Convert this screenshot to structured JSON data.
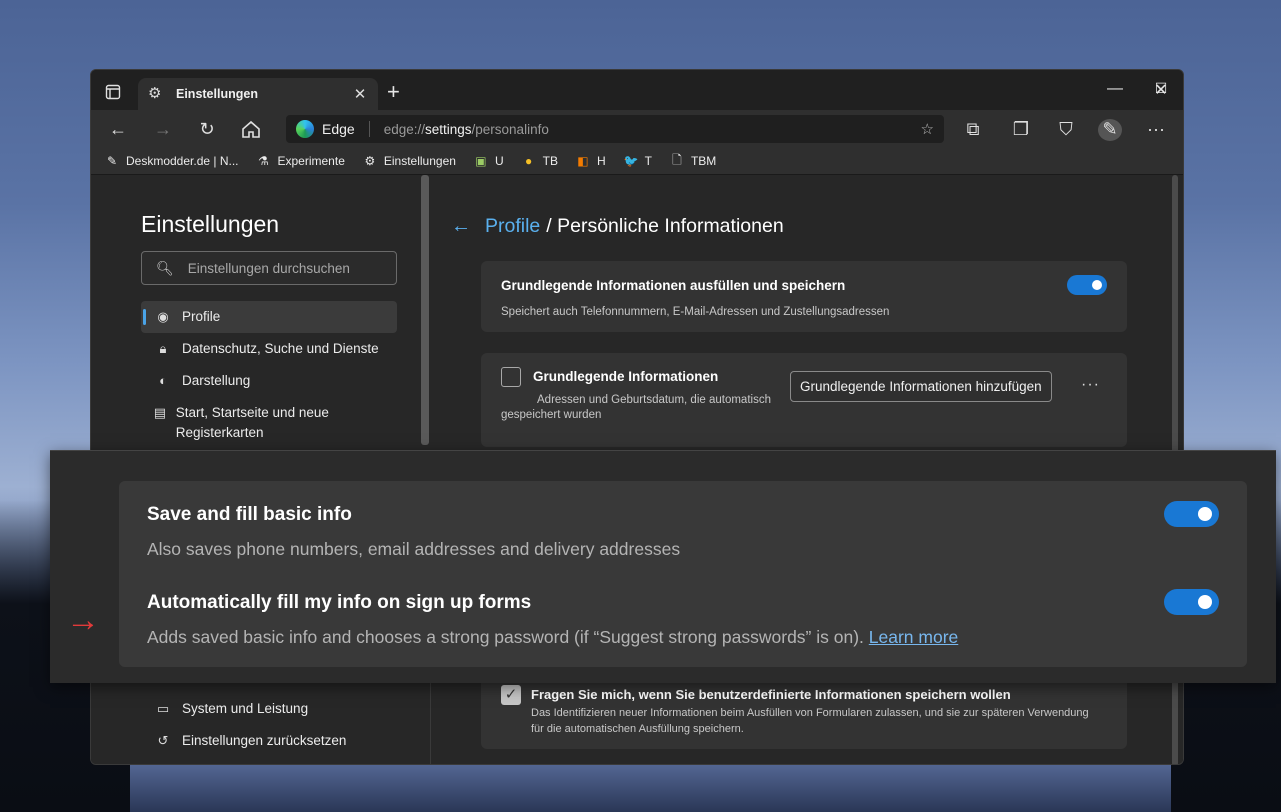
{
  "window": {
    "tab_title": "Einstellungen",
    "tab_icon": "gear-icon",
    "colors": {
      "accent": "#1978d4",
      "link": "#5ab0ee",
      "bg": "#272727"
    }
  },
  "toolbar": {
    "site_name": "Edge",
    "url_prefix": "edge://",
    "url_bold": "settings",
    "url_suffix": "/personalinfo"
  },
  "bookmarks": [
    {
      "label": "Deskmodder.de | N...",
      "icon": "pen-icon"
    },
    {
      "label": "Experimente",
      "icon": "flask-icon"
    },
    {
      "label": "Einstellungen",
      "icon": "gear-icon"
    },
    {
      "label": "U",
      "icon": "app-icon"
    },
    {
      "label": "TB",
      "icon": "emoji-icon"
    },
    {
      "label": "H",
      "icon": "orange-app-icon"
    },
    {
      "label": "T",
      "icon": "twitter-icon"
    },
    {
      "label": "TBM",
      "icon": "document-icon"
    }
  ],
  "sidebar": {
    "title": "Einstellungen",
    "search_placeholder": "Einstellungen durchsuchen",
    "items": [
      {
        "label": "Profile",
        "icon": "profile-icon",
        "active": true
      },
      {
        "label": "Datenschutz, Suche und Dienste",
        "icon": "lock-icon"
      },
      {
        "label": "Darstellung",
        "icon": "palette-icon"
      },
      {
        "label": "Start, Startseite und neue Registerkarten",
        "icon": "tabs-icon"
      },
      {
        "label": "System und Leistung",
        "icon": "laptop-icon"
      },
      {
        "label": "Einstellungen zurücksetzen",
        "icon": "reset-icon"
      }
    ]
  },
  "main": {
    "breadcrumb_link": "Profile",
    "breadcrumb_current": "/ Persönliche Informationen",
    "card1": {
      "title": "Grundlegende Informationen ausfüllen und speichern",
      "desc": "Speichert auch Telefonnummern, E-Mail-Adressen und Zustellungsadressen",
      "enabled": true
    },
    "card2": {
      "title": "Grundlegende Informationen",
      "desc": "Adressen und Geburtsdatum, die automatisch gespeichert wurden",
      "button": "Grundlegende Informationen hinzufügen",
      "more": "···"
    },
    "card3": {
      "title": "Fragen Sie mich, wenn Sie benutzerdefinierte Informationen speichern wollen",
      "desc": "Das Identifizieren neuer Informationen beim Ausfüllen von Formularen zulassen, und sie zur späteren Verwendung für die automatischen Ausfüllung speichern.",
      "checked": true
    }
  },
  "overlay": {
    "row1_title": "Save and fill basic info",
    "row1_desc": "Also saves phone numbers, email addresses and delivery addresses",
    "row2_title": "Automatically fill my info on sign up forms",
    "row2_desc": "Adds saved basic info and chooses a strong password (if “Suggest strong passwords” is on).",
    "learn_more": "Learn more"
  }
}
